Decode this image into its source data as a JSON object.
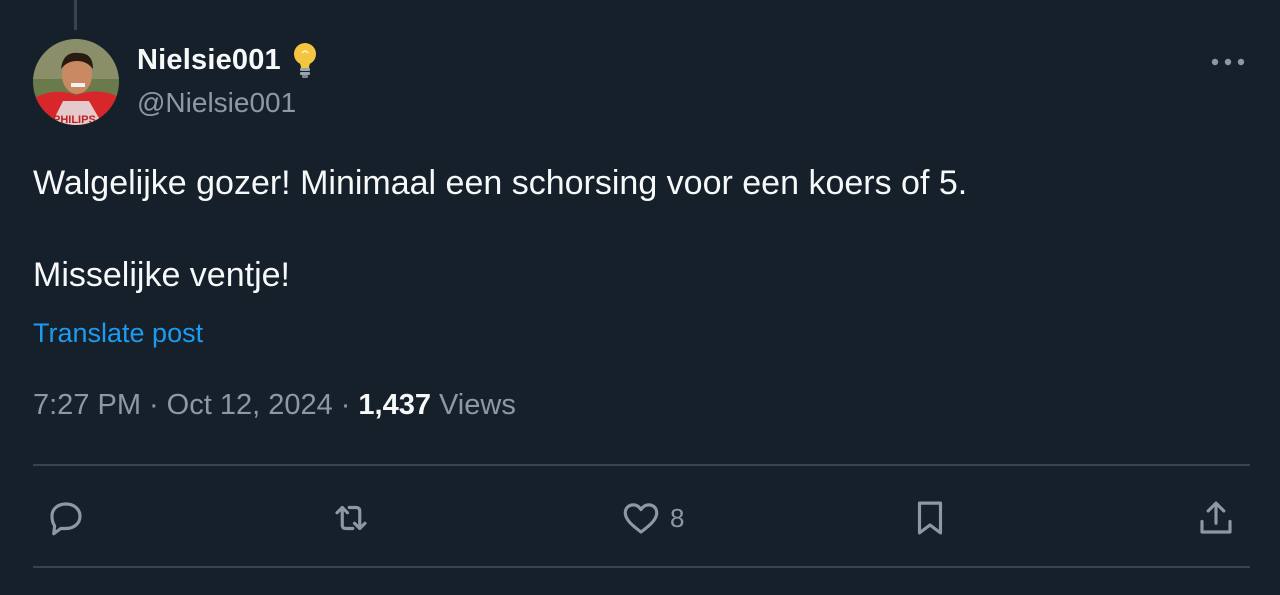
{
  "author": {
    "display_name": "Nielsie001",
    "handle": "@Nielsie001",
    "badge_icon": "lightbulb-icon"
  },
  "tweet": {
    "text": "Walgelijke gozer! Minimaal een schorsing voor een koers of 5.\n\nMisselijke ventje!",
    "translate_label": "Translate post"
  },
  "meta": {
    "time": "7:27 PM",
    "date": "Oct 12, 2024",
    "separator": "·",
    "views_count": "1,437",
    "views_label": "Views"
  },
  "actions": {
    "reply": {
      "icon": "reply-icon"
    },
    "repost": {
      "icon": "repost-icon"
    },
    "like": {
      "icon": "heart-icon",
      "count": "8"
    },
    "bookmark": {
      "icon": "bookmark-icon"
    },
    "share": {
      "icon": "share-icon"
    }
  },
  "colors": {
    "background": "#15202b",
    "link": "#1d9bf0",
    "secondary_text": "#8b98a5",
    "divider": "#38444d"
  }
}
